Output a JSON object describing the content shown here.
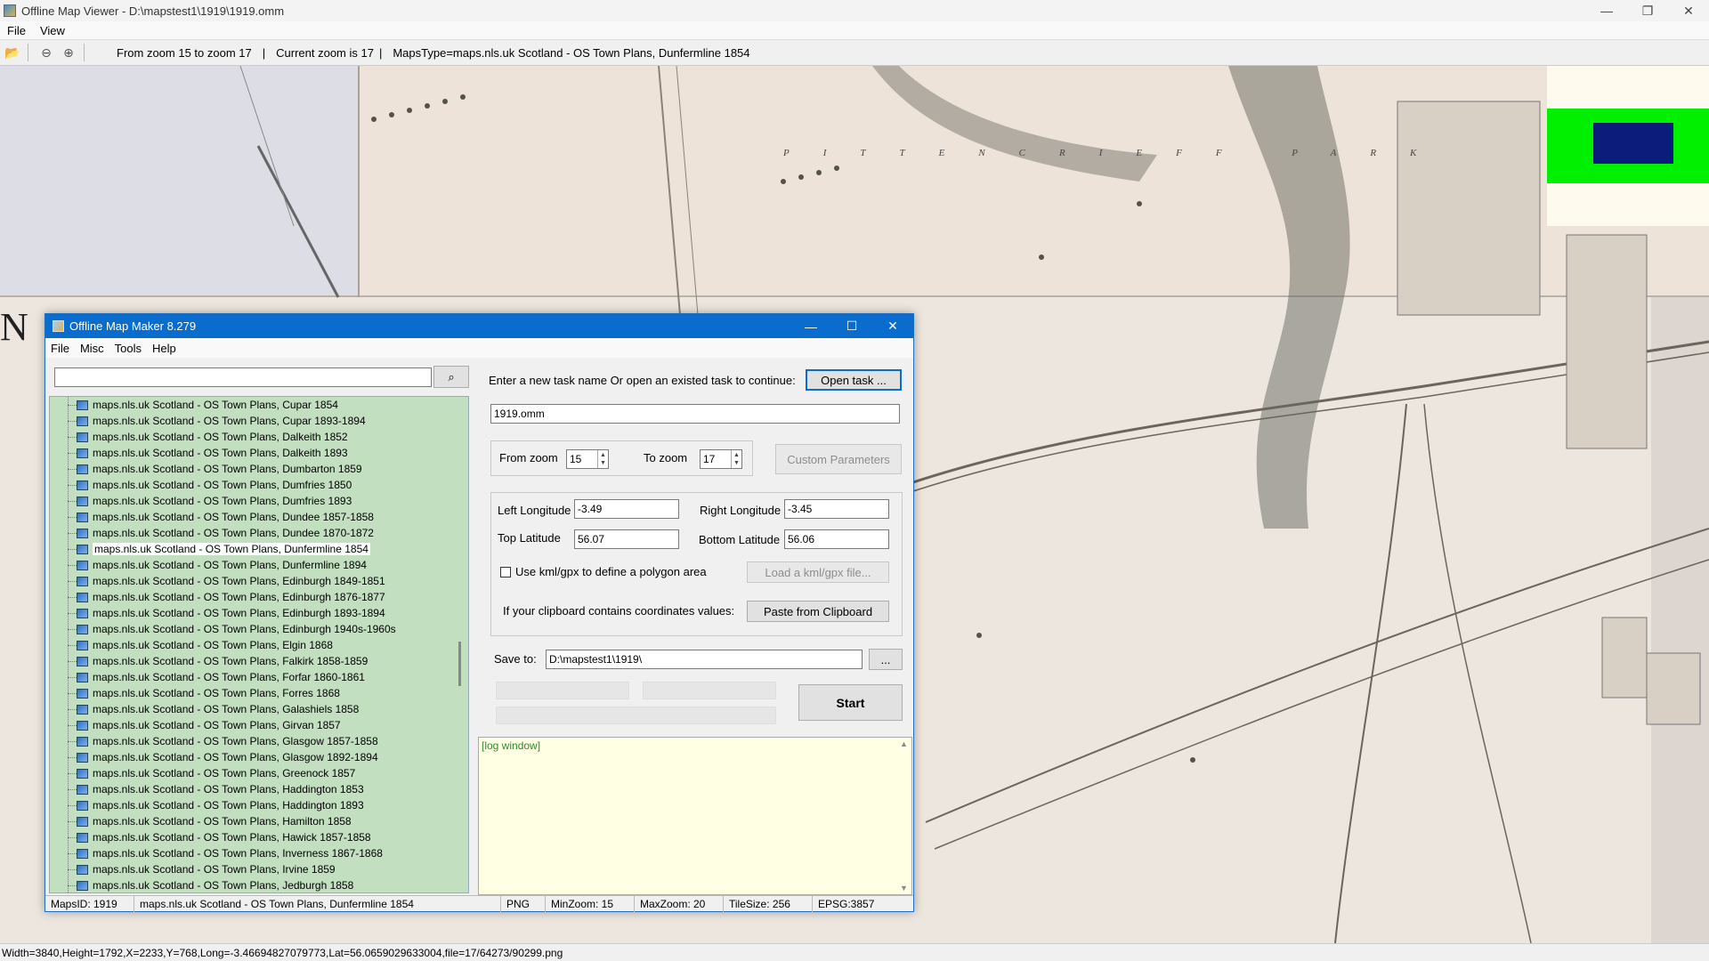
{
  "window": {
    "title": "Offline Map Viewer - D:\\mapstest1\\1919\\1919.omm",
    "controls": {
      "minimize": "—",
      "restore": "❐",
      "close": "✕"
    }
  },
  "menu": [
    "File",
    "View"
  ],
  "toolbar": {
    "zoom_range": "From zoom 15 to zoom 17",
    "current_zoom": "Current zoom is 17",
    "maps_type": "MapsType=maps.nls.uk Scotland - OS Town Plans, Dunfermline 1854",
    "separator": "|",
    "icons": [
      "open-folder-icon",
      "zoom-out-icon",
      "zoom-in-icon"
    ]
  },
  "map": {
    "park_label": "PITTENCRIEFF PARK",
    "big_letter": "N",
    "overview_colors": {
      "background": "#fefbee",
      "viewport": "#00f000",
      "focus": "#0b1c7a"
    }
  },
  "status": "Width=3840,Height=1792,X=2233,Y=768,Long=-3.46694827079773,Lat=56.0659029633004,file=17/64273/90299.png",
  "dialog": {
    "title": "Offline Map Maker 8.279",
    "controls": {
      "minimize": "—",
      "maximize": "☐",
      "close": "✕"
    },
    "menu": [
      "File",
      "Misc",
      "Tools",
      "Help"
    ],
    "search": {
      "value": "",
      "placeholder": "",
      "button": "⌕"
    },
    "tree_items": [
      "maps.nls.uk Scotland - OS Town Plans, Cupar 1854",
      "maps.nls.uk Scotland - OS Town Plans, Cupar 1893-1894",
      "maps.nls.uk Scotland - OS Town Plans, Dalkeith 1852",
      "maps.nls.uk Scotland - OS Town Plans, Dalkeith 1893",
      "maps.nls.uk Scotland - OS Town Plans, Dumbarton 1859",
      "maps.nls.uk Scotland - OS Town Plans, Dumfries 1850",
      "maps.nls.uk Scotland - OS Town Plans, Dumfries 1893",
      "maps.nls.uk Scotland - OS Town Plans, Dundee 1857-1858",
      "maps.nls.uk Scotland - OS Town Plans, Dundee 1870-1872",
      "maps.nls.uk Scotland - OS Town Plans, Dunfermline 1854",
      "maps.nls.uk Scotland - OS Town Plans, Dunfermline 1894",
      "maps.nls.uk Scotland - OS Town Plans, Edinburgh 1849-1851",
      "maps.nls.uk Scotland - OS Town Plans, Edinburgh 1876-1877",
      "maps.nls.uk Scotland - OS Town Plans, Edinburgh 1893-1894",
      "maps.nls.uk Scotland - OS Town Plans, Edinburgh 1940s-1960s",
      "maps.nls.uk Scotland - OS Town Plans, Elgin 1868",
      "maps.nls.uk Scotland - OS Town Plans, Falkirk 1858-1859",
      "maps.nls.uk Scotland - OS Town Plans, Forfar 1860-1861",
      "maps.nls.uk Scotland - OS Town Plans, Forres 1868",
      "maps.nls.uk Scotland - OS Town Plans, Galashiels 1858",
      "maps.nls.uk Scotland - OS Town Plans, Girvan 1857",
      "maps.nls.uk Scotland - OS Town Plans, Glasgow 1857-1858",
      "maps.nls.uk Scotland - OS Town Plans, Glasgow 1892-1894",
      "maps.nls.uk Scotland - OS Town Plans, Greenock 1857",
      "maps.nls.uk Scotland - OS Town Plans, Haddington 1853",
      "maps.nls.uk Scotland - OS Town Plans, Haddington 1893",
      "maps.nls.uk Scotland - OS Town Plans, Hamilton 1858",
      "maps.nls.uk Scotland - OS Town Plans, Hawick 1857-1858",
      "maps.nls.uk Scotland - OS Town Plans, Inverness 1867-1868",
      "maps.nls.uk Scotland - OS Town Plans, Irvine 1859",
      "maps.nls.uk Scotland - OS Town Plans, Jedburgh 1858"
    ],
    "selected_item": "maps.nls.uk Scotland - OS Town Plans, Dunfermline 1854",
    "task_prompt": "Enter a new task name Or open an existed task to continue:",
    "open_task": "Open task ...",
    "task_name": "1919.omm",
    "from_zoom_label": "From zoom",
    "from_zoom": "15",
    "to_zoom_label": "To zoom",
    "to_zoom": "17",
    "custom_params": "Custom Parameters",
    "left_lon_label": "Left Longitude",
    "left_lon": "-3.49",
    "right_lon_label": "Right Longitude",
    "right_lon": "-3.45",
    "top_lat_label": "Top Latitude",
    "top_lat": "56.07",
    "bottom_lat_label": "Bottom Latitude",
    "bottom_lat": "56.06",
    "kml_label": "Use kml/gpx to define a polygon area",
    "load_kml": "Load a kml/gpx file...",
    "clipboard_label": "If your clipboard contains coordinates values:",
    "paste_clipboard": "Paste from Clipboard",
    "save_to_label": "Save to:",
    "save_to": "D:\\mapstest1\\1919\\",
    "browse": "...",
    "start": "Start",
    "log_text": "[log window]",
    "status": {
      "maps_id": "MapsID: 1919",
      "maps_name": "maps.nls.uk Scotland - OS Town Plans, Dunfermline 1854",
      "format": "PNG",
      "min_zoom": "MinZoom: 15",
      "max_zoom": "MaxZoom: 20",
      "tile_size": "TileSize: 256",
      "epsg": "EPSG:3857"
    }
  }
}
